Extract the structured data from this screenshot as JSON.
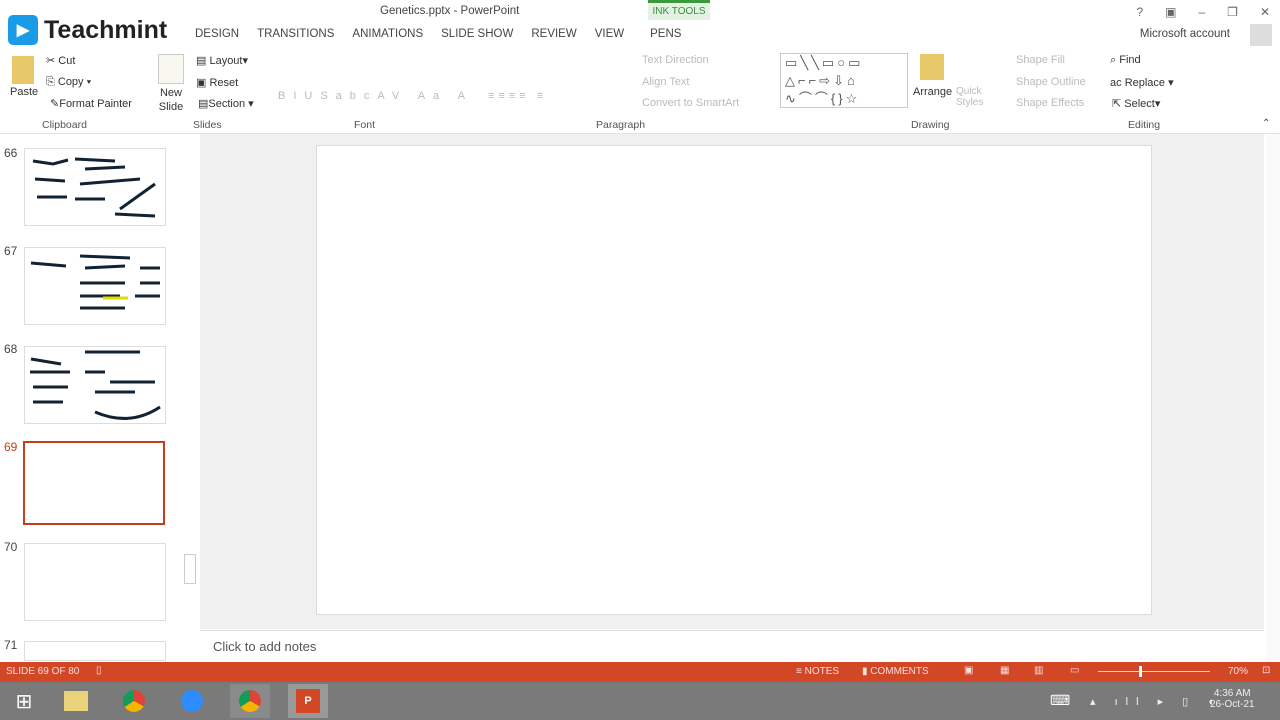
{
  "window": {
    "title": "Genetics.pptx - PowerPoint",
    "context_tab": "INK TOOLS",
    "account": "Microsoft account",
    "controls": [
      "?",
      "▣",
      "–",
      "❐",
      "✕"
    ]
  },
  "logo": {
    "text": "Teachmint"
  },
  "tabs": [
    "DESIGN",
    "TRANSITIONS",
    "ANIMATIONS",
    "SLIDE SHOW",
    "REVIEW",
    "VIEW",
    "PENS"
  ],
  "ribbon": {
    "clipboard": {
      "paste": "Paste",
      "cut": "Cut",
      "copy": "Copy",
      "format_painter": "Format Painter",
      "label": "Clipboard"
    },
    "slides": {
      "new_slide": "New Slide",
      "layout": "Layout",
      "reset": "Reset",
      "section": "Section",
      "label": "Slides"
    },
    "font": {
      "label": "Font"
    },
    "paragraph": {
      "text_direction": "Text Direction",
      "align_text": "Align Text",
      "convert": "Convert to SmartArt",
      "label": "Paragraph"
    },
    "drawing": {
      "arrange": "Arrange",
      "quick_styles": "Quick Styles",
      "shape_fill": "Shape Fill",
      "shape_outline": "Shape Outline",
      "shape_effects": "Shape Effects",
      "label": "Drawing"
    },
    "editing": {
      "find": "Find",
      "replace": "Replace",
      "select": "Select",
      "label": "Editing"
    }
  },
  "thumbnails": [
    {
      "num": "66"
    },
    {
      "num": "67"
    },
    {
      "num": "68"
    },
    {
      "num": "69",
      "selected": true
    },
    {
      "num": "70"
    },
    {
      "num": "71"
    }
  ],
  "notes": {
    "placeholder": "Click to add notes"
  },
  "status": {
    "slide": "SLIDE 69 OF 80",
    "notes": "NOTES",
    "comments": "COMMENTS",
    "zoom": "70%",
    "zoom_fraction": 0.7
  },
  "taskbar": {
    "time": "4:36 AM",
    "date": "26-Oct-21"
  },
  "colors": {
    "accent": "#d24726",
    "selected": "#c43e1c"
  }
}
